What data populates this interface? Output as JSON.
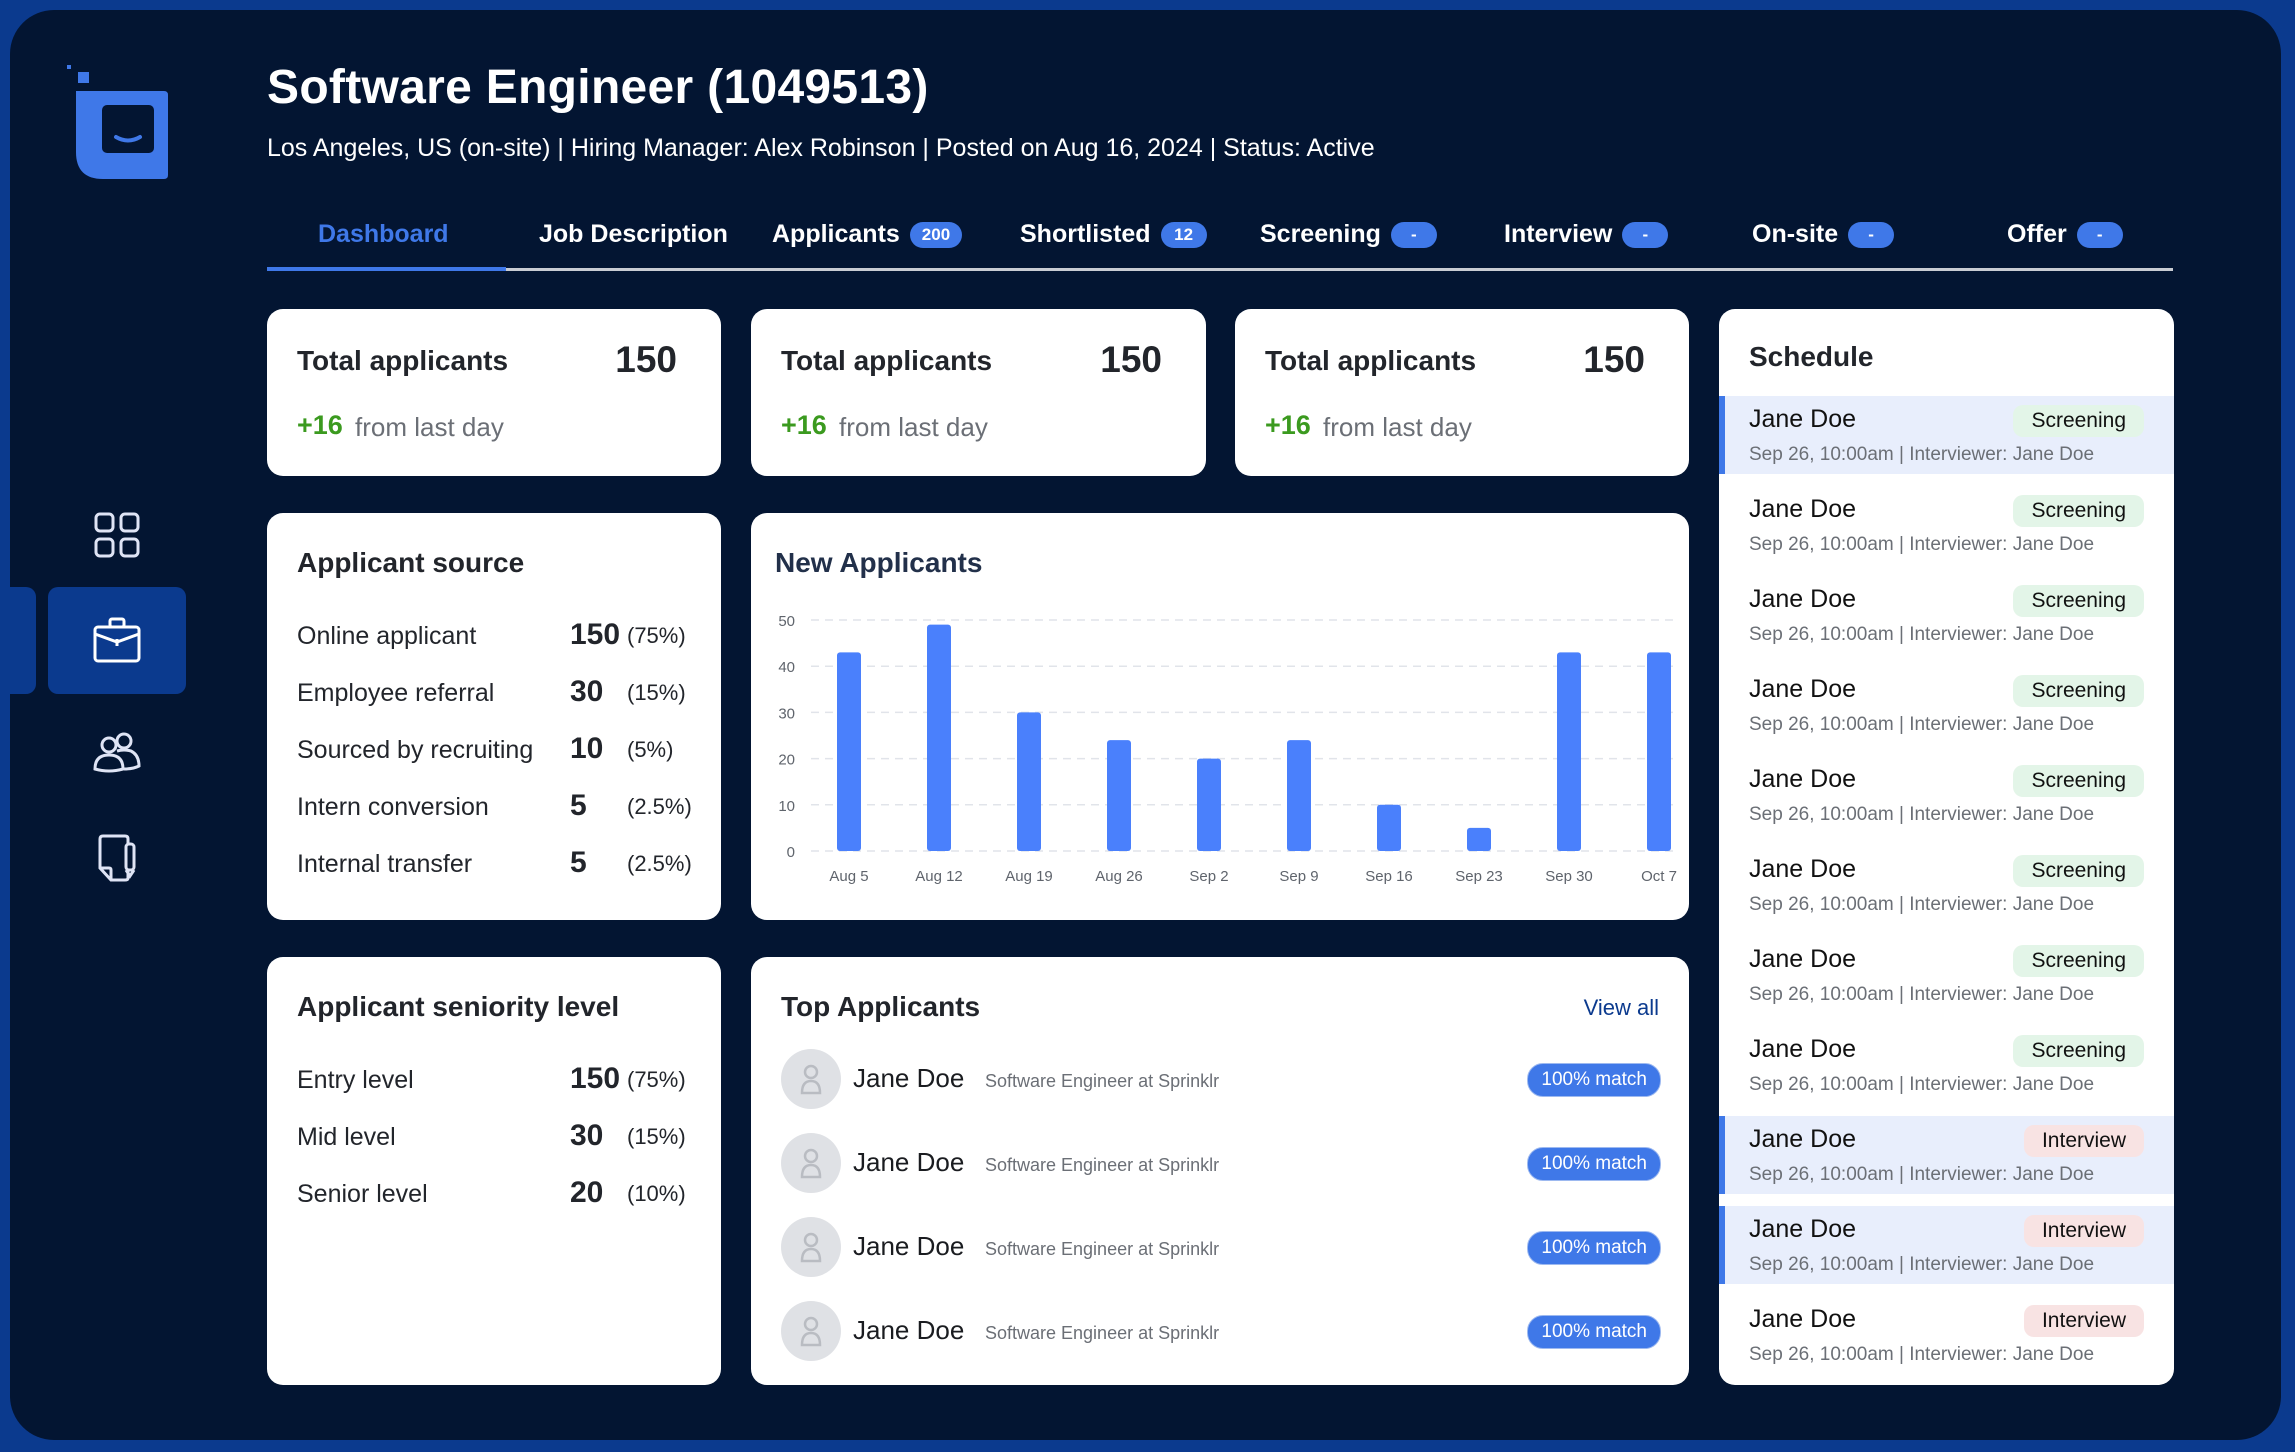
{
  "header": {
    "title": "Software Engineer (1049513)",
    "subtitle": "Los Angeles, US (on-site) | Hiring Manager: Alex Robinson | Posted on Aug 16, 2024 | Status: Active"
  },
  "sidebar": {
    "items": [
      {
        "name": "dashboard",
        "icon": "grid-icon",
        "active": false
      },
      {
        "name": "jobs",
        "icon": "briefcase-icon",
        "active": true
      },
      {
        "name": "people",
        "icon": "people-icon",
        "active": false
      },
      {
        "name": "documents",
        "icon": "document-icon",
        "active": false
      }
    ]
  },
  "tabs": [
    {
      "label": "Dashboard",
      "badge": null,
      "active": true
    },
    {
      "label": "Job Description",
      "badge": null,
      "active": false
    },
    {
      "label": "Applicants",
      "badge": "200",
      "active": false
    },
    {
      "label": "Shortlisted",
      "badge": "12",
      "active": false
    },
    {
      "label": "Screening",
      "badge": "-",
      "active": false
    },
    {
      "label": "Interview",
      "badge": "-",
      "active": false
    },
    {
      "label": "On-site",
      "badge": "-",
      "active": false
    },
    {
      "label": "Offer",
      "badge": "-",
      "active": false
    }
  ],
  "stats": [
    {
      "title": "Total applicants",
      "value": "150",
      "delta": "+16",
      "delta_label": "from last day"
    },
    {
      "title": "Total applicants",
      "value": "150",
      "delta": "+16",
      "delta_label": "from last day"
    },
    {
      "title": "Total applicants",
      "value": "150",
      "delta": "+16",
      "delta_label": "from last day"
    }
  ],
  "source": {
    "title": "Applicant source",
    "rows": [
      {
        "label": "Online applicant",
        "value": "150",
        "pct": "(75%)"
      },
      {
        "label": "Employee referral",
        "value": "30",
        "pct": "(15%)"
      },
      {
        "label": "Sourced by recruiting",
        "value": "10",
        "pct": "(5%)"
      },
      {
        "label": "Intern conversion",
        "value": "5",
        "pct": "(2.5%)"
      },
      {
        "label": "Internal transfer",
        "value": "5",
        "pct": "(2.5%)"
      }
    ]
  },
  "seniority": {
    "title": "Applicant seniority level",
    "rows": [
      {
        "label": "Entry level",
        "value": "150",
        "pct": "(75%)"
      },
      {
        "label": "Mid level",
        "value": "30",
        "pct": "(15%)"
      },
      {
        "label": "Senior level",
        "value": "20",
        "pct": "(10%)"
      }
    ]
  },
  "chart_data": {
    "type": "bar",
    "title": "New Applicants",
    "categories": [
      "Aug 5",
      "Aug 12",
      "Aug 19",
      "Aug 26",
      "Sep 2",
      "Sep 9",
      "Sep 16",
      "Sep 23",
      "Sep 30",
      "Oct 7"
    ],
    "values": [
      43,
      49,
      30,
      24,
      20,
      24,
      10,
      5,
      43,
      43
    ],
    "xlabel": "",
    "ylabel": "",
    "ylim": [
      0,
      50
    ],
    "yticks": [
      0,
      10,
      20,
      30,
      40,
      50
    ],
    "grid": true,
    "bar_color": "#4a80fc"
  },
  "top_applicants": {
    "title": "Top Applicants",
    "view_all": "View all",
    "items": [
      {
        "name": "Jane Doe",
        "role": "Software Engineer at Sprinklr",
        "match": "100% match"
      },
      {
        "name": "Jane Doe",
        "role": "Software Engineer at Sprinklr",
        "match": "100% match"
      },
      {
        "name": "Jane Doe",
        "role": "Software Engineer at Sprinklr",
        "match": "100% match"
      },
      {
        "name": "Jane Doe",
        "role": "Software Engineer at Sprinklr",
        "match": "100% match"
      }
    ]
  },
  "schedule": {
    "title": "Schedule",
    "items": [
      {
        "name": "Jane Doe",
        "meta": "Sep 26, 10:00am | Interviewer: Jane Doe",
        "stage": "Screening",
        "highlighted": true
      },
      {
        "name": "Jane Doe",
        "meta": "Sep 26, 10:00am | Interviewer: Jane Doe",
        "stage": "Screening",
        "highlighted": false
      },
      {
        "name": "Jane Doe",
        "meta": "Sep 26, 10:00am | Interviewer: Jane Doe",
        "stage": "Screening",
        "highlighted": false
      },
      {
        "name": "Jane Doe",
        "meta": "Sep 26, 10:00am | Interviewer: Jane Doe",
        "stage": "Screening",
        "highlighted": false
      },
      {
        "name": "Jane Doe",
        "meta": "Sep 26, 10:00am | Interviewer: Jane Doe",
        "stage": "Screening",
        "highlighted": false
      },
      {
        "name": "Jane Doe",
        "meta": "Sep 26, 10:00am | Interviewer: Jane Doe",
        "stage": "Screening",
        "highlighted": false
      },
      {
        "name": "Jane Doe",
        "meta": "Sep 26, 10:00am | Interviewer: Jane Doe",
        "stage": "Screening",
        "highlighted": false
      },
      {
        "name": "Jane Doe",
        "meta": "Sep 26, 10:00am | Interviewer: Jane Doe",
        "stage": "Screening",
        "highlighted": false
      },
      {
        "name": "Jane Doe",
        "meta": "Sep 26, 10:00am | Interviewer: Jane Doe",
        "stage": "Interview",
        "highlighted": true
      },
      {
        "name": "Jane Doe",
        "meta": "Sep 26, 10:00am | Interviewer: Jane Doe",
        "stage": "Interview",
        "highlighted": true
      },
      {
        "name": "Jane Doe",
        "meta": "Sep 26, 10:00am | Interviewer: Jane Doe",
        "stage": "Interview",
        "highlighted": false
      }
    ]
  },
  "colors": {
    "accent": "#3f78e8",
    "background": "#031532",
    "frame": "#0b3a8e",
    "positive": "#3b9a1f",
    "screening_badge": "#e3f5e8",
    "interview_badge": "#f8e3e3"
  }
}
